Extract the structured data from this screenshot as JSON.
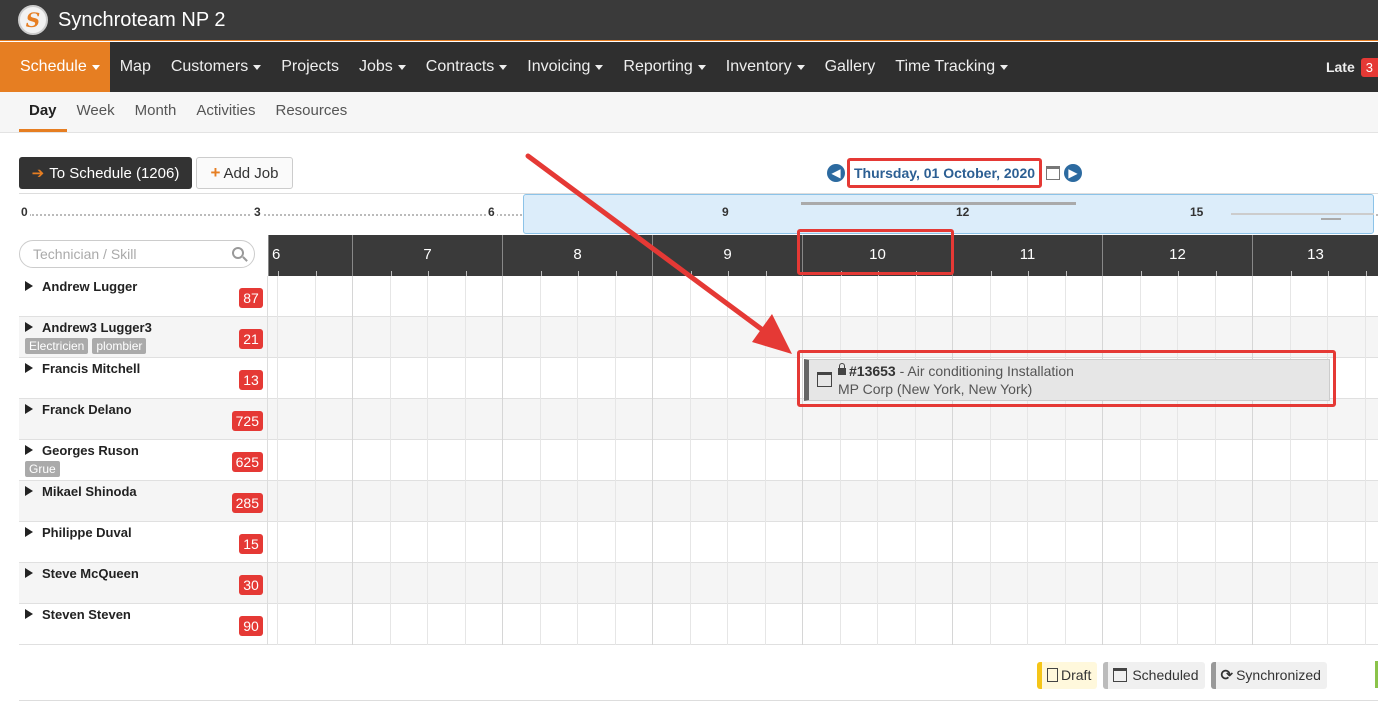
{
  "app": {
    "title": "Synchroteam NP 2",
    "logo_letter": "S"
  },
  "nav": {
    "items": [
      {
        "label": "Schedule",
        "dropdown": true,
        "active": true
      },
      {
        "label": "Map",
        "dropdown": false
      },
      {
        "label": "Customers",
        "dropdown": true
      },
      {
        "label": "Projects",
        "dropdown": false
      },
      {
        "label": "Jobs",
        "dropdown": true
      },
      {
        "label": "Contracts",
        "dropdown": true
      },
      {
        "label": "Invoicing",
        "dropdown": true
      },
      {
        "label": "Reporting",
        "dropdown": true
      },
      {
        "label": "Inventory",
        "dropdown": true
      },
      {
        "label": "Gallery",
        "dropdown": false
      },
      {
        "label": "Time Tracking",
        "dropdown": true
      }
    ],
    "late_label": "Late",
    "late_count": "3"
  },
  "subnav": {
    "items": [
      "Day",
      "Week",
      "Month",
      "Activities",
      "Resources"
    ],
    "active": "Day"
  },
  "toolbar": {
    "to_schedule_label": "To Schedule (1206)",
    "add_job_label": "Add Job",
    "date": "Thursday, 01 October, 2020"
  },
  "overview": {
    "labels": [
      "0",
      "3",
      "6",
      "9",
      "12",
      "15"
    ]
  },
  "search": {
    "placeholder": "Technician / Skill"
  },
  "hours": [
    "6",
    "7",
    "8",
    "9",
    "10",
    "11",
    "12",
    "13"
  ],
  "technicians": [
    {
      "name": "Andrew Lugger",
      "count": "87",
      "skills": []
    },
    {
      "name": "Andrew3 Lugger3",
      "count": "21",
      "skills": [
        "Electricien",
        "plombier"
      ]
    },
    {
      "name": "Francis Mitchell",
      "count": "13",
      "skills": []
    },
    {
      "name": "Franck Delano",
      "count": "725",
      "skills": []
    },
    {
      "name": "Georges Ruson",
      "count": "625",
      "skills": [
        "Grue"
      ]
    },
    {
      "name": "Mikael Shinoda",
      "count": "285",
      "skills": []
    },
    {
      "name": "Philippe Duval",
      "count": "15",
      "skills": []
    },
    {
      "name": "Steve McQueen",
      "count": "30",
      "skills": []
    },
    {
      "name": "Steven Steven",
      "count": "90",
      "skills": []
    }
  ],
  "job": {
    "number": "#13653",
    "title": " - Air conditioning Installation",
    "customer": "MP Corp (New York, New York)"
  },
  "legend": {
    "draft": "Draft",
    "scheduled": "Scheduled",
    "synchronized": "Synchronized"
  },
  "colors": {
    "accent": "#e67e22",
    "badge": "#e53935",
    "highlight": "#e53935"
  }
}
